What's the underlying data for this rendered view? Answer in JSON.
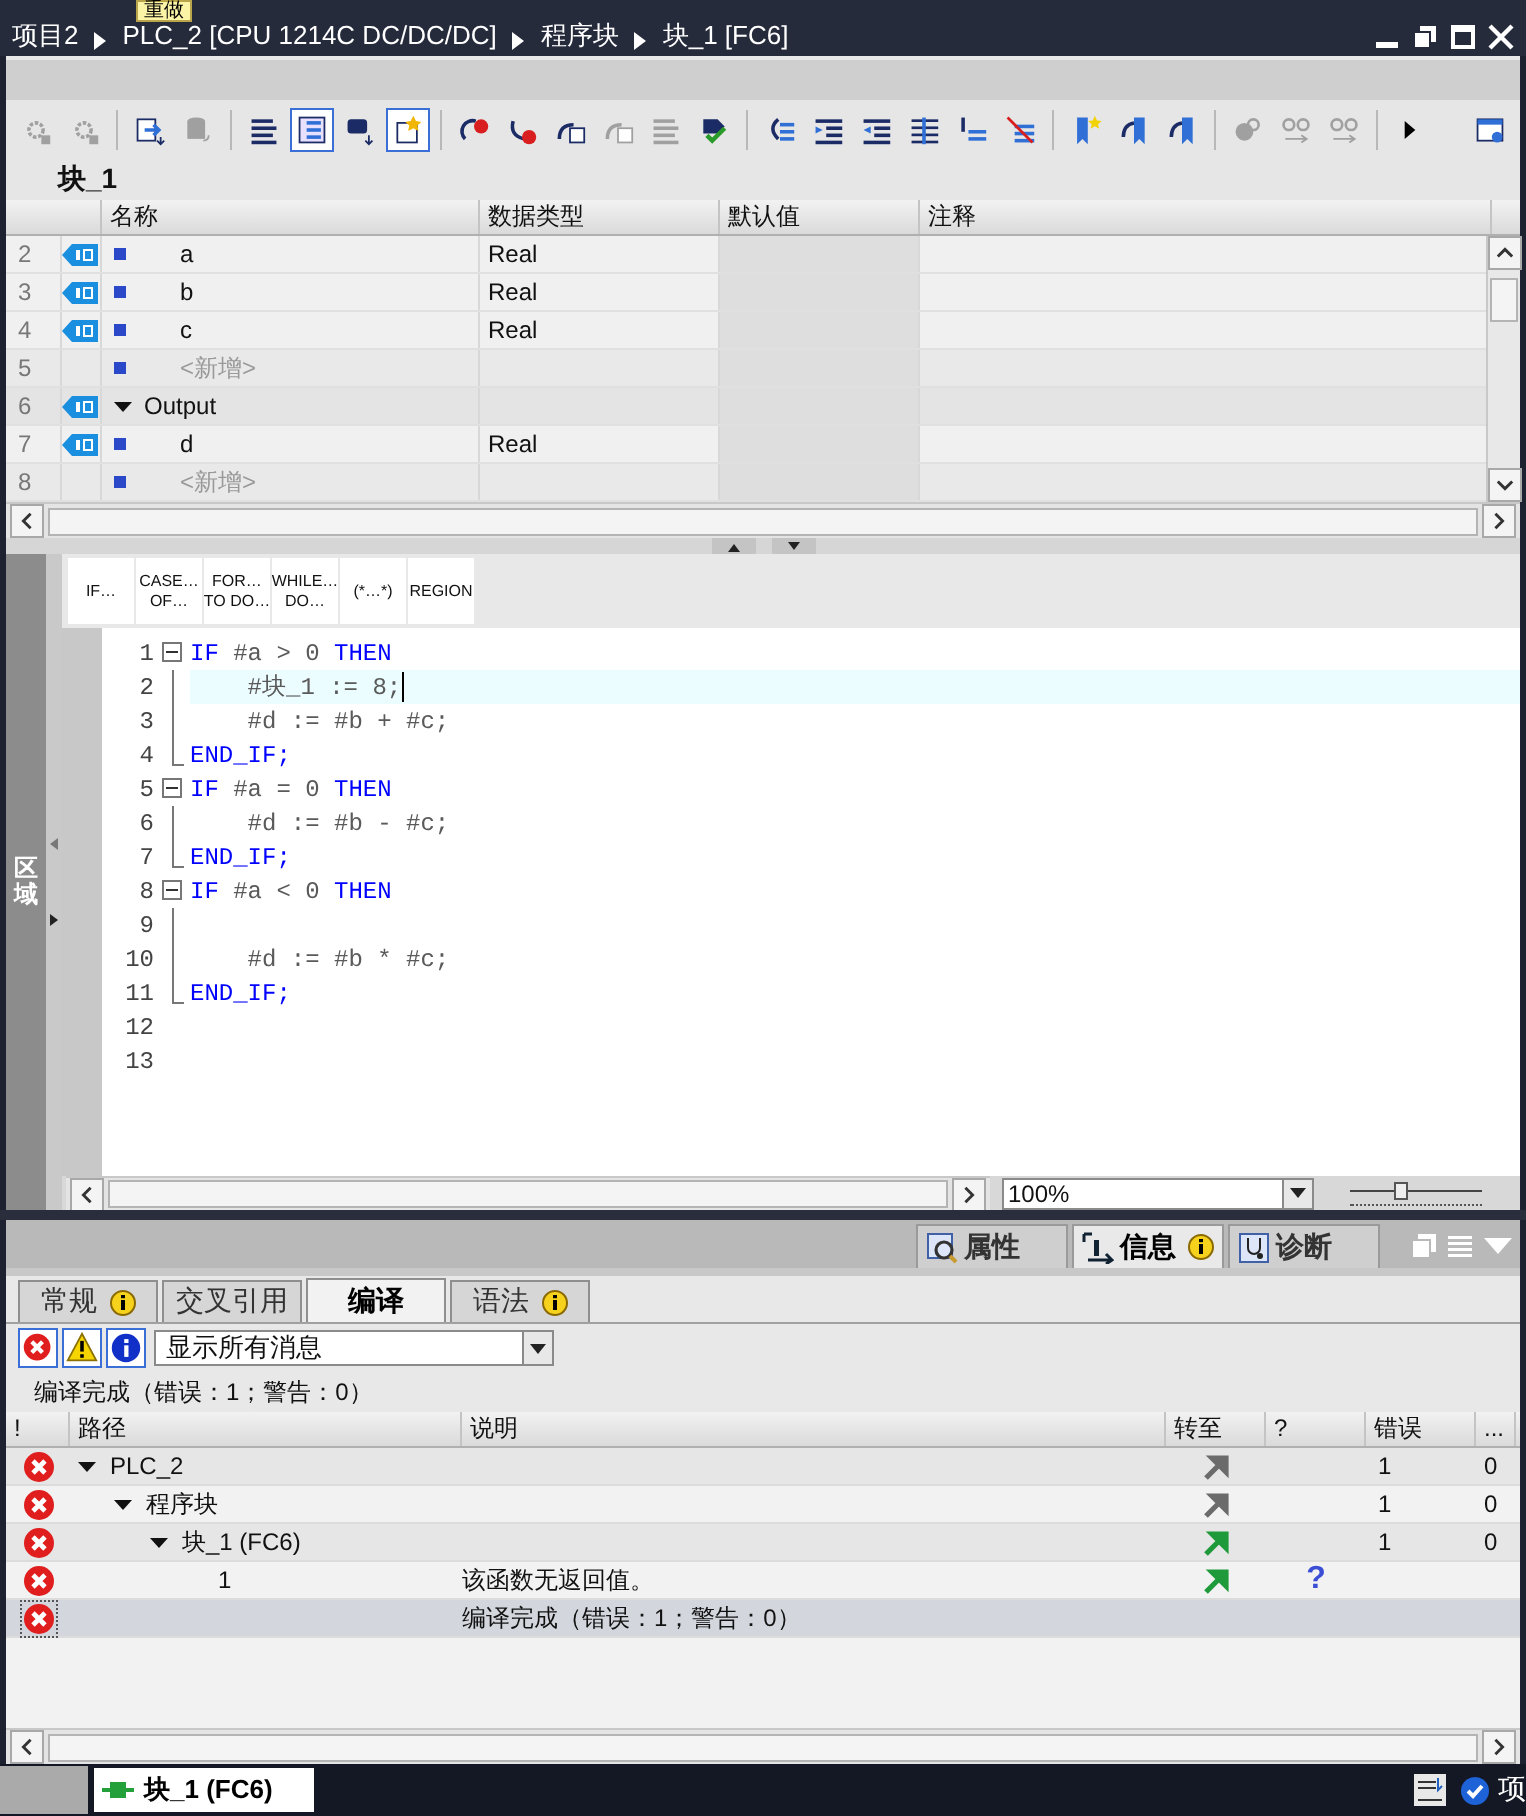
{
  "title_bar": {
    "breadcrumb": [
      "项目2",
      "PLC_2 [CPU 1214C DC/DC/DC]",
      "程序块",
      "块_1 [FC6]"
    ],
    "tooltip": "重做"
  },
  "toolbar": [
    {
      "disabled": true,
      "on": false
    },
    {
      "disabled": true,
      "on": false
    },
    {
      "disabled": false,
      "on": false
    },
    {
      "disabled": true,
      "on": false
    },
    {
      "disabled": false,
      "on": false
    },
    {
      "disabled": false,
      "on": true
    },
    {
      "disabled": false,
      "on": false
    },
    {
      "disabled": false,
      "on": true
    },
    {
      "disabled": false,
      "on": false
    },
    {
      "disabled": false,
      "on": false
    },
    {
      "disabled": false,
      "on": false
    },
    {
      "disabled": true,
      "on": false
    },
    {
      "disabled": true,
      "on": false
    },
    {
      "disabled": false,
      "on": false
    },
    {
      "disabled": false,
      "on": false
    },
    {
      "disabled": false,
      "on": false
    },
    {
      "disabled": false,
      "on": false
    },
    {
      "disabled": false,
      "on": false
    },
    {
      "disabled": false,
      "on": false
    },
    {
      "disabled": false,
      "on": false
    },
    {
      "disabled": false,
      "on": false
    },
    {
      "disabled": false,
      "on": false
    },
    {
      "disabled": false,
      "on": false
    },
    {
      "disabled": true,
      "on": false
    },
    {
      "disabled": true,
      "on": false
    },
    {
      "disabled": true,
      "on": false
    },
    {
      "disabled": false,
      "on": false
    },
    {
      "disabled": false,
      "on": false
    }
  ],
  "block_title": "块_1",
  "interface_table": {
    "columns": [
      "名称",
      "数据类型",
      "默认值",
      "注释"
    ],
    "rows": [
      {
        "number": "2",
        "kind": "param",
        "name": "a",
        "data_type": "Real"
      },
      {
        "number": "3",
        "kind": "param",
        "name": "b",
        "data_type": "Real"
      },
      {
        "number": "4",
        "kind": "param",
        "name": "c",
        "data_type": "Real"
      },
      {
        "number": "5",
        "kind": "add",
        "name": "<新增>"
      },
      {
        "number": "6",
        "kind": "section",
        "name": "Output",
        "expanded": true
      },
      {
        "number": "7",
        "kind": "param",
        "name": "d",
        "data_type": "Real"
      },
      {
        "number": "8",
        "kind": "add",
        "name": "<新增>"
      }
    ]
  },
  "editor": {
    "side_label": "区域",
    "snippets": [
      {
        "lines": [
          "IF…"
        ]
      },
      {
        "lines": [
          "CASE…",
          "OF…"
        ]
      },
      {
        "lines": [
          "FOR…",
          "TO DO…"
        ]
      },
      {
        "lines": [
          "WHILE…",
          "DO…"
        ]
      },
      {
        "lines": [
          "(*…*)"
        ]
      },
      {
        "lines": [
          "REGION"
        ]
      }
    ],
    "lines": [
      {
        "number": "1",
        "kind": "block_start",
        "current": false,
        "tokens": [
          {
            "kind": "keyword",
            "text": "IF"
          },
          {
            "kind": "plain",
            "text": " #a > 0 "
          },
          {
            "kind": "keyword",
            "text": "THEN"
          }
        ]
      },
      {
        "number": "2",
        "kind": "block_body",
        "current": true,
        "tokens": [
          {
            "kind": "plain",
            "text": "    #块_1 := 8;"
          }
        ]
      },
      {
        "number": "3",
        "kind": "block_body",
        "current": false,
        "tokens": [
          {
            "kind": "plain",
            "text": "    #d := #b + #c;"
          }
        ]
      },
      {
        "number": "4",
        "kind": "block_end",
        "current": false,
        "tokens": [
          {
            "kind": "keyword",
            "text": "END_IF;"
          }
        ]
      },
      {
        "number": "5",
        "kind": "block_start",
        "current": false,
        "tokens": [
          {
            "kind": "keyword",
            "text": "IF"
          },
          {
            "kind": "plain",
            "text": " #a = 0 "
          },
          {
            "kind": "keyword",
            "text": "THEN"
          }
        ]
      },
      {
        "number": "6",
        "kind": "block_body",
        "current": false,
        "tokens": [
          {
            "kind": "plain",
            "text": "    #d := #b - #c;"
          }
        ]
      },
      {
        "number": "7",
        "kind": "block_end",
        "current": false,
        "tokens": [
          {
            "kind": "keyword",
            "text": "END_IF;"
          }
        ]
      },
      {
        "number": "8",
        "kind": "block_start",
        "current": false,
        "tokens": [
          {
            "kind": "keyword",
            "text": "IF"
          },
          {
            "kind": "plain",
            "text": " #a < 0 "
          },
          {
            "kind": "keyword",
            "text": "THEN"
          }
        ]
      },
      {
        "number": "9",
        "kind": "block_body",
        "current": false
      },
      {
        "number": "10",
        "kind": "block_body",
        "current": false,
        "tokens": [
          {
            "kind": "plain",
            "text": "    #d := #b * #c;"
          }
        ]
      },
      {
        "number": "11",
        "kind": "block_end",
        "current": false,
        "tokens": [
          {
            "kind": "keyword",
            "text": "END_IF;"
          }
        ]
      },
      {
        "number": "12",
        "kind": "plain",
        "current": false
      },
      {
        "number": "13",
        "kind": "plain",
        "current": false
      }
    ],
    "zoom": "100%",
    "zoom_slider": {
      "level": 0.38
    }
  },
  "inspector_tabs": [
    {
      "label": "属性",
      "selected": false,
      "badge": false
    },
    {
      "label": "信息",
      "selected": true,
      "badge": true
    },
    {
      "label": "诊断",
      "selected": false,
      "badge": false
    }
  ],
  "sub_tabs": [
    {
      "label": "常规",
      "selected": false,
      "badge": true
    },
    {
      "label": "交叉引用",
      "selected": false,
      "badge": false
    },
    {
      "label": "编译",
      "selected": true,
      "badge": false
    },
    {
      "label": "语法",
      "selected": false,
      "badge": true
    }
  ],
  "filters": [
    {
      "kind": "error",
      "on": true
    },
    {
      "kind": "warning",
      "on": true
    },
    {
      "kind": "info",
      "on": true
    }
  ],
  "filter_select": "显示所有消息",
  "summary": "编译完成（错误：1；警告：0）",
  "messages": {
    "columns": [
      "!",
      "路径",
      "说明",
      "转至",
      "?",
      "错误",
      "..."
    ],
    "rows": [
      {
        "kind": "error",
        "path": "PLC_2",
        "expanded": true,
        "goto": {
          "active": false
        },
        "errors": "1",
        "warnings": "0",
        "selected": false,
        "children": [
          {
            "kind": "error",
            "path": "程序块",
            "expanded": true,
            "goto": {
              "active": false
            },
            "errors": "1",
            "warnings": "0",
            "selected": false,
            "children": [
              {
                "kind": "error",
                "path": "块_1 (FC6)",
                "expanded": true,
                "goto": {
                  "active": true
                },
                "errors": "1",
                "warnings": "0",
                "selected": false,
                "children": [
                  {
                    "kind": "error",
                    "path": "1",
                    "description": "该函数无返回值。",
                    "goto": {
                      "active": true
                    },
                    "help": "?",
                    "selected": false
                  }
                ]
              }
            ]
          }
        ]
      },
      {
        "kind": "error",
        "description": "编译完成（错误：1；警告：0）",
        "selected": true
      }
    ]
  },
  "taskbar": {
    "tab": "块_1 (FC6)",
    "checkbox": {
      "label": "项",
      "checked": true
    }
  }
}
